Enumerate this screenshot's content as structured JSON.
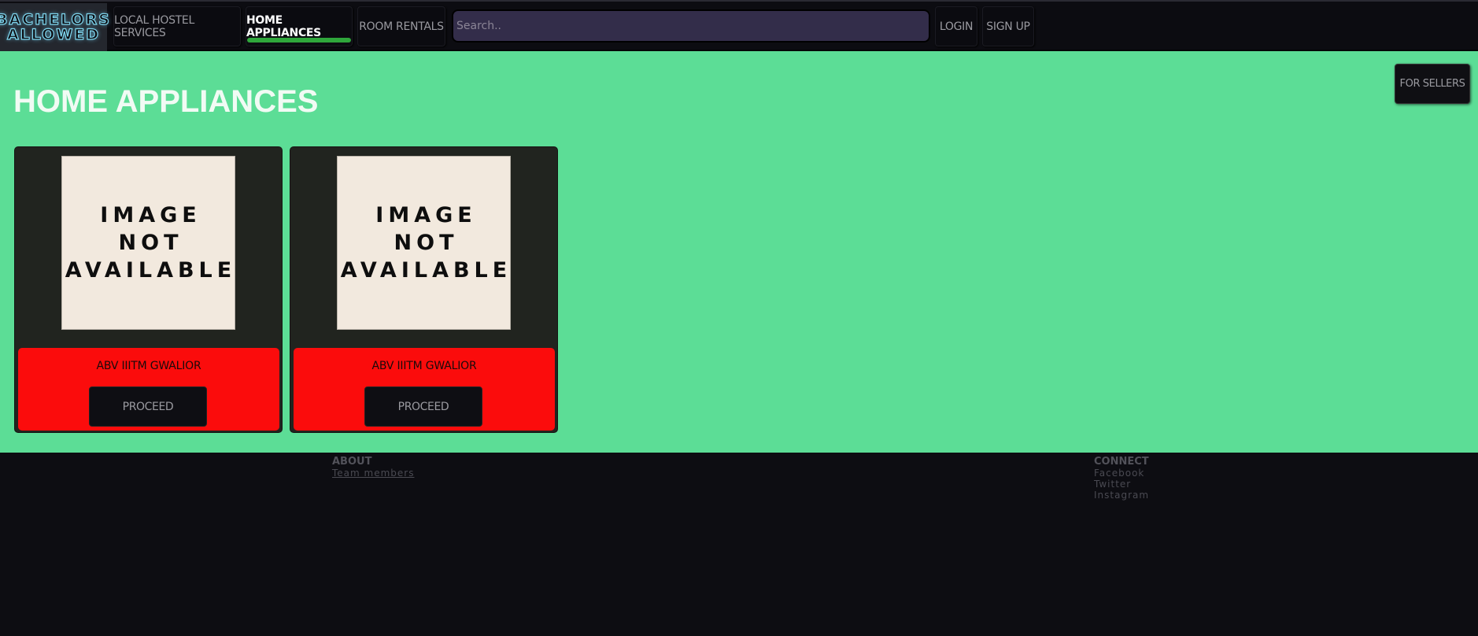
{
  "logo": {
    "line1": "BACHELORS",
    "line2": "ALLOWED"
  },
  "nav": {
    "items": [
      {
        "label": "LOCAL HOSTEL SERVICES"
      },
      {
        "label": "HOME APPLIANCES",
        "active": true
      },
      {
        "label": "ROOM RENTALS"
      }
    ],
    "search_placeholder": "Search..",
    "login": "LOGIN",
    "signup": "SIGN UP"
  },
  "main": {
    "title": "HOME APPLIANCES",
    "for_sellers": "FOR SELLERS",
    "cards": [
      {
        "image_text": [
          "IMAGE",
          "NOT",
          "AVAILABLE"
        ],
        "location": "ABV IIITM GWALIOR",
        "button": "PROCEED"
      },
      {
        "image_text": [
          "IMAGE",
          "NOT",
          "AVAILABLE"
        ],
        "location": "ABV IIITM GWALIOR",
        "button": "PROCEED"
      }
    ]
  },
  "footer": {
    "about": {
      "heading": "ABOUT",
      "links": [
        "Team members"
      ]
    },
    "connect": {
      "heading": "CONNECT",
      "links": [
        "Facebook",
        "Twitter",
        "Instagram"
      ]
    }
  },
  "colors": {
    "main_bg": "#5cdd96",
    "card_panel": "#fb0c0c",
    "active_indicator": "#2fa63b",
    "search_bg": "#332d4a",
    "logo_glow": "#7fd6ee"
  }
}
